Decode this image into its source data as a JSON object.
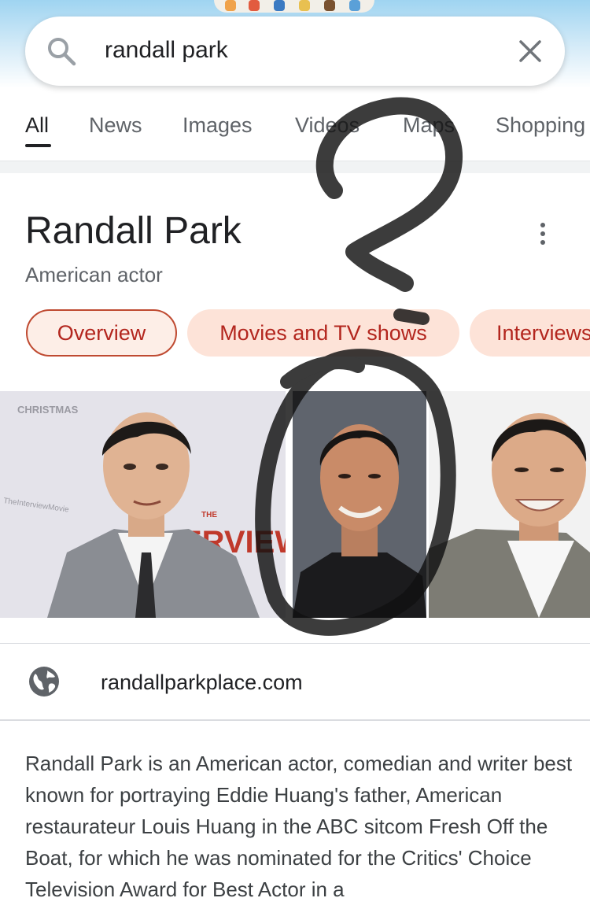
{
  "search": {
    "query": "randall park",
    "search_icon": "search-icon",
    "clear_icon": "close-icon"
  },
  "tabs": [
    {
      "label": "All",
      "active": true
    },
    {
      "label": "News"
    },
    {
      "label": "Images"
    },
    {
      "label": "Videos"
    },
    {
      "label": "Maps"
    },
    {
      "label": "Shopping"
    }
  ],
  "knowledge_panel": {
    "title": "Randall Park",
    "subtitle": "American actor",
    "more_icon": "more-vert-icon",
    "chips": [
      {
        "label": "Overview",
        "active": true
      },
      {
        "label": "Movies and TV shows"
      },
      {
        "label": "Interviews"
      }
    ],
    "photo_texts": {
      "poster_top": "CHRISTMAS",
      "poster_mid": "TheInterviewMovie",
      "poster_small": "THE",
      "poster_title": "ERVIEW"
    },
    "website": {
      "icon": "globe-icon",
      "label": "randallparkplace.com"
    },
    "description": "Randall Park is an American actor, comedian and writer best known for portraying Eddie Huang's father, American restaurateur Louis Huang in the ABC sitcom Fresh Off the Boat, for which he was nominated for the Critics' Choice Television Award for Best Actor in a"
  },
  "colors": {
    "chip_text": "#b3261e",
    "chip_bg": "#fde3d8",
    "chip_border": "#bf4a31",
    "header_top": "#9fd4f1"
  }
}
